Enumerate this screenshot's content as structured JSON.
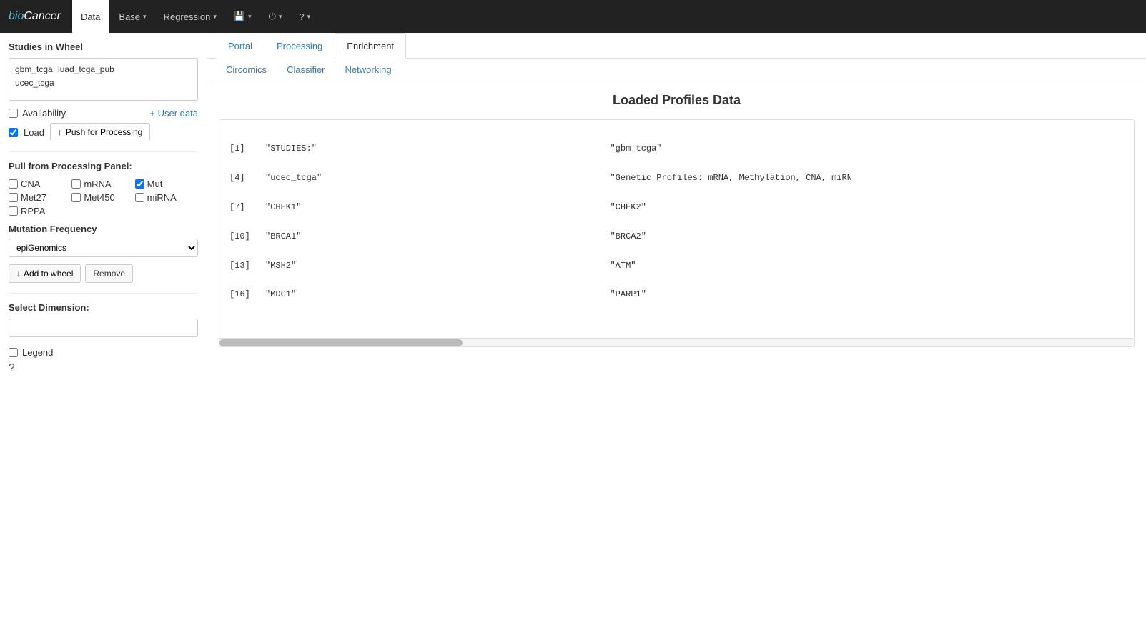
{
  "app": {
    "brand": "bioCancer",
    "brand_accent": "bio",
    "nav": [
      {
        "id": "data",
        "label": "Data",
        "active": true
      },
      {
        "id": "base",
        "label": "Base",
        "dropdown": true
      },
      {
        "id": "regression",
        "label": "Regression",
        "dropdown": true
      },
      {
        "id": "save",
        "label": "💾",
        "dropdown": true
      },
      {
        "id": "power",
        "label": "⏻",
        "dropdown": true
      },
      {
        "id": "help",
        "label": "?",
        "dropdown": true
      }
    ]
  },
  "sidebar": {
    "studies_in_wheel_label": "Studies in Wheel",
    "studies": [
      "gbm_tcga",
      "luad_tcga_pub",
      "ucec_tcga"
    ],
    "availability_label": "Availability",
    "load_label": "Load",
    "push_label": "Push for Processing",
    "user_data_link": "+ User data",
    "pull_section_label": "Pull from Processing Panel:",
    "checkboxes": [
      {
        "id": "cna",
        "label": "CNA",
        "checked": false
      },
      {
        "id": "mrna",
        "label": "mRNA",
        "checked": false
      },
      {
        "id": "mut",
        "label": "Mut",
        "checked": true
      },
      {
        "id": "met27",
        "label": "Met27",
        "checked": false
      },
      {
        "id": "met450",
        "label": "Met450",
        "checked": false
      },
      {
        "id": "mirna",
        "label": "miRNA",
        "checked": false
      },
      {
        "id": "rppa",
        "label": "RPPA",
        "checked": false
      }
    ],
    "mutation_freq_label": "Mutation Frequency",
    "dropdown_options": [
      "epiGenomics"
    ],
    "dropdown_selected": "epiGenomics",
    "add_to_wheel_label": "Add to wheel",
    "remove_label": "Remove",
    "select_dimension_label": "Select Dimension:",
    "dimension_value": "",
    "legend_label": "Legend",
    "question_mark": "?"
  },
  "content": {
    "tabs_primary": [
      {
        "id": "portal",
        "label": "Portal",
        "active": false
      },
      {
        "id": "processing",
        "label": "Processing",
        "active": false
      },
      {
        "id": "enrichment",
        "label": "Enrichment",
        "active": true
      }
    ],
    "tabs_secondary": [
      {
        "id": "circomics",
        "label": "Circomics",
        "active": false
      },
      {
        "id": "classifier",
        "label": "Classifier",
        "active": false
      },
      {
        "id": "networking",
        "label": "Networking",
        "active": false
      }
    ],
    "data_title": "Loaded Profiles Data",
    "data_rows": [
      {
        "index": "[1]",
        "key": "\"STUDIES:\"",
        "value": "\"gbm_tcga\""
      },
      {
        "index": "[4]",
        "key": "\"ucec_tcga\"",
        "value": "\"Genetic Profiles: mRNA, Methylation, CNA, miRN"
      },
      {
        "index": "[7]",
        "key": "\"CHEK1\"",
        "value": "\"CHEK2\""
      },
      {
        "index": "[10]",
        "key": "\"BRCA1\"",
        "value": "\"BRCA2\""
      },
      {
        "index": "[13]",
        "key": "\"MSH2\"",
        "value": "\"ATM\""
      },
      {
        "index": "[16]",
        "key": "\"MDC1\"",
        "value": "\"PARP1\""
      }
    ]
  }
}
